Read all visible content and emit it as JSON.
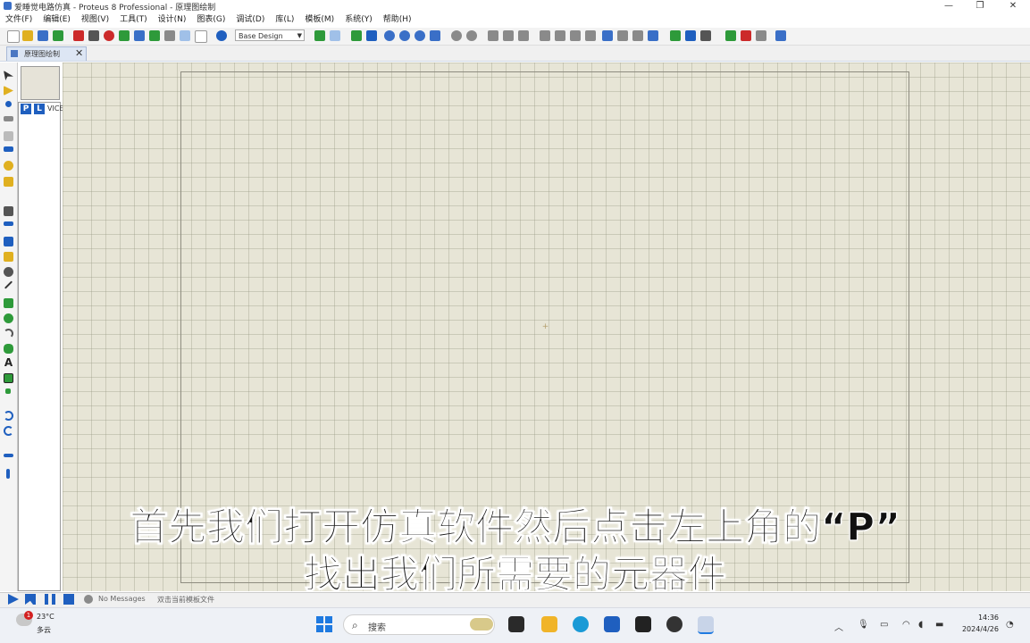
{
  "window": {
    "title": "爱睡觉电路仿真 - Proteus 8 Professional - 原理图绘制",
    "minimize": "—",
    "restore": "❐",
    "close": "✕"
  },
  "menu": [
    "文件(F)",
    "编辑(E)",
    "视图(V)",
    "工具(T)",
    "设计(N)",
    "图表(G)",
    "调试(D)",
    "库(L)",
    "模板(M)",
    "系统(Y)",
    "帮助(H)"
  ],
  "toolbar": {
    "design_select": "Base Design",
    "colors": {
      "blue": "#1f5fbf",
      "green": "#2e9a3a",
      "red": "#cc2a2a",
      "gray": "#8a8a8a",
      "yellow": "#e0b020"
    }
  },
  "document_tab": {
    "label": "原理图绘制",
    "close": "✕"
  },
  "device_selector": {
    "p_label": "P",
    "l_label": "L",
    "devices_label": "VICE"
  },
  "subtitles": {
    "line1": "首先我们打开仿真软件然后点击左上角的“P”",
    "line2": "找出我们所需要的元器件"
  },
  "status": {
    "messages": "No Messages",
    "tip": "双击当前模板文件"
  },
  "taskbar": {
    "weather_badge": "1",
    "weather_temp": "23°C",
    "weather_desc": "多云",
    "search_placeholder": "搜索",
    "time": "14:36",
    "date": "2024/4/26"
  }
}
